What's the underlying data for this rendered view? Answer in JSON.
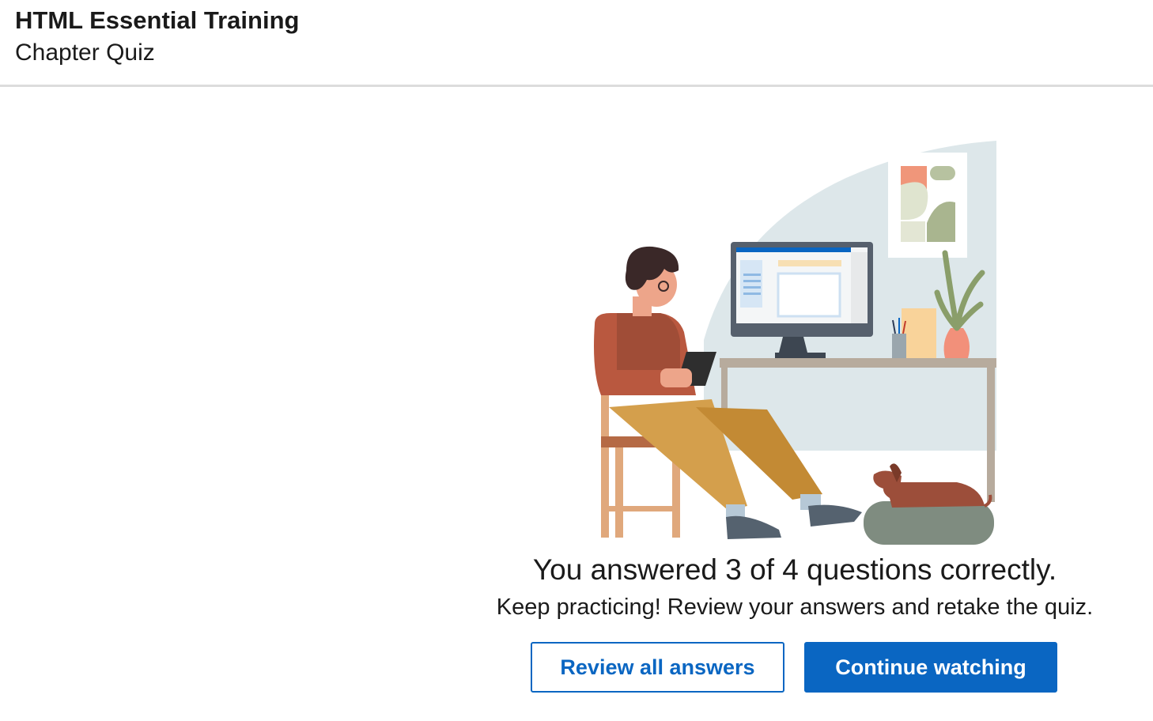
{
  "header": {
    "course_title": "HTML Essential Training",
    "subtitle": "Chapter Quiz"
  },
  "result": {
    "heading": "You answered 3 of 4 questions correctly.",
    "message": "Keep practicing! Review your answers and retake the quiz.",
    "correct": 3,
    "total": 4
  },
  "actions": {
    "review_label": "Review all answers",
    "continue_label": "Continue watching"
  },
  "colors": {
    "accent": "#0a66c2",
    "divider": "#dcdcdc"
  },
  "illustration": {
    "icon": "person-at-desk-with-dog-illustration"
  }
}
